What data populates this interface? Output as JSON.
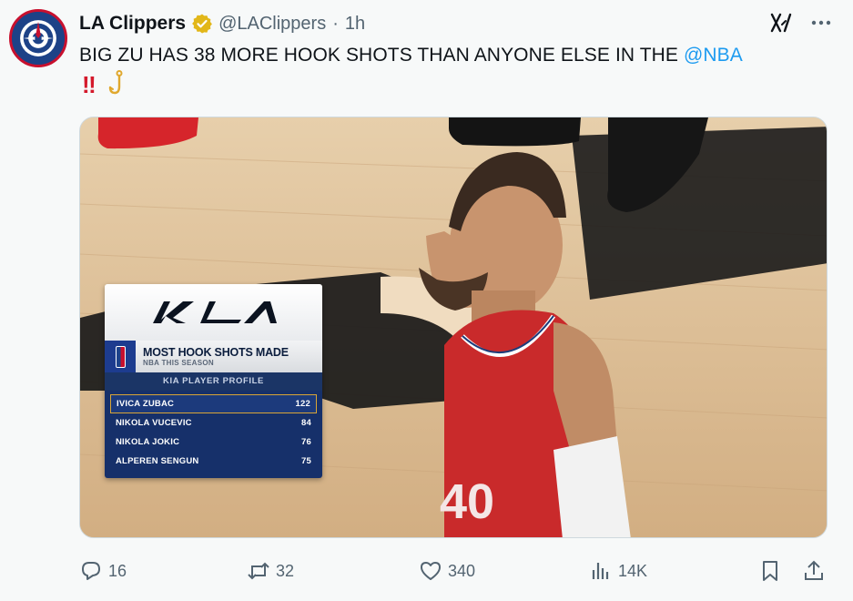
{
  "tweet": {
    "display_name": "LA Clippers",
    "handle": "@LAClippers",
    "separator": "·",
    "time": "1h",
    "text_prefix": "BIG ZU HAS 38 MORE HOOK SHOTS THAN ANYONE ELSE IN THE ",
    "text_mention": "@NBA",
    "emoji_bang": "‼",
    "icons": {
      "avatar": "la-clippers-logo",
      "verified": "verified-gold-badge-icon",
      "grok": "grok-icon",
      "more": "more-icon",
      "hook_emoji": "hook-icon"
    },
    "colors": {
      "mention": "#1d9bf0",
      "verified": "#e2b719",
      "bang": "#d4192b"
    }
  },
  "graphic": {
    "sponsor_logo": "KIA",
    "title": "MOST HOOK SHOTS MADE",
    "subtitle": "NBA THIS SEASON",
    "profile_label": "KIA PLAYER PROFILE",
    "rows": [
      {
        "name": "IVICA ZUBAC",
        "value": "122"
      },
      {
        "name": "NIKOLA VUCEVIC",
        "value": "84"
      },
      {
        "name": "NIKOLA JOKIC",
        "value": "76"
      },
      {
        "name": "ALPEREN SENGUN",
        "value": "75"
      }
    ],
    "jersey_number_partial": "40"
  },
  "actions": {
    "replies": "16",
    "reposts": "32",
    "likes": "340",
    "views": "14K"
  }
}
